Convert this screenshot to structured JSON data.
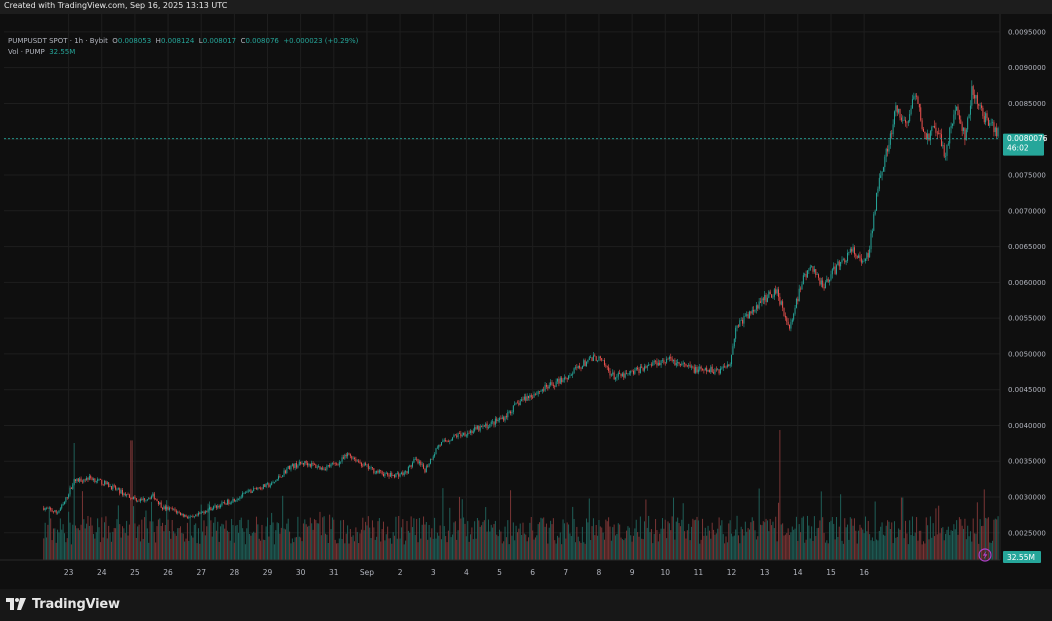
{
  "header": {
    "snapshot_label": "Created with TradingView.com, Sep 16, 2025 13:13 UTC"
  },
  "legend": {
    "symbol": "PUMPUSDT SPOT · 1h · Bybit",
    "open_label": "O",
    "open": "0.008053",
    "high_label": "H",
    "high": "0.008124",
    "low_label": "L",
    "low": "0.008017",
    "close_label": "C",
    "close": "0.008076",
    "change": "+0.000023 (+0.29%)",
    "volume_label": "Vol · PUMP",
    "volume": "32.55M"
  },
  "price_tag": {
    "price": "0.0080076",
    "countdown": "46:02"
  },
  "volume_tag": "32.55M",
  "branding": {
    "name": "TradingView"
  },
  "colors": {
    "up": "#26a69a",
    "down": "#ef5350",
    "up_volume": "#1f5f58",
    "down_volume": "#7a3535",
    "grid": "#1e1e1e",
    "background": "#0f0f0f"
  },
  "icons": {
    "alert": "lightning-icon"
  },
  "chart_data": {
    "type": "candlestick",
    "symbol": "PUMPUSDT",
    "interval": "1h",
    "exchange": "Bybit",
    "y_ticks": [
      "0.0025000",
      "0.0030000",
      "0.0035000",
      "0.0040000",
      "0.0045000",
      "0.0050000",
      "0.0055000",
      "0.0060000",
      "0.0065000",
      "0.0070000",
      "0.0075000",
      "0.0080000",
      "0.0085000",
      "0.0090000",
      "0.0095000"
    ],
    "ylim": [
      0.00212,
      0.00975
    ],
    "x_labels": [
      "23",
      "24",
      "25",
      "26",
      "27",
      "28",
      "29",
      "30",
      "31",
      "Sep",
      "2",
      "3",
      "4",
      "5",
      "6",
      "7",
      "8",
      "9",
      "10",
      "11",
      "12",
      "13",
      "14",
      "15",
      "16"
    ],
    "x_range_days": [
      -0.9,
      24.6
    ],
    "last_price": 0.0080076,
    "price_path": [
      [
        -0.9,
        0.00285
      ],
      [
        -0.5,
        0.00278
      ],
      [
        -0.3,
        0.0029
      ],
      [
        0.0,
        0.00322
      ],
      [
        0.5,
        0.00327
      ],
      [
        1.0,
        0.00318
      ],
      [
        1.5,
        0.00305
      ],
      [
        2.0,
        0.00295
      ],
      [
        2.4,
        0.00302
      ],
      [
        2.7,
        0.00285
      ],
      [
        3.0,
        0.00282
      ],
      [
        3.3,
        0.00275
      ],
      [
        3.6,
        0.0027
      ],
      [
        4.0,
        0.00282
      ],
      [
        4.5,
        0.0029
      ],
      [
        5.0,
        0.003
      ],
      [
        5.5,
        0.00312
      ],
      [
        6.0,
        0.00318
      ],
      [
        6.5,
        0.00342
      ],
      [
        7.0,
        0.00348
      ],
      [
        7.5,
        0.0034
      ],
      [
        8.0,
        0.00348
      ],
      [
        8.3,
        0.0036
      ],
      [
        8.7,
        0.00346
      ],
      [
        9.0,
        0.00338
      ],
      [
        9.5,
        0.0033
      ],
      [
        10.0,
        0.00333
      ],
      [
        10.3,
        0.00352
      ],
      [
        10.6,
        0.00338
      ],
      [
        11.0,
        0.00372
      ],
      [
        11.5,
        0.00385
      ],
      [
        12.0,
        0.00392
      ],
      [
        12.5,
        0.004
      ],
      [
        13.0,
        0.00412
      ],
      [
        13.5,
        0.00435
      ],
      [
        14.0,
        0.00447
      ],
      [
        14.5,
        0.00458
      ],
      [
        15.0,
        0.00472
      ],
      [
        15.5,
        0.0049
      ],
      [
        15.8,
        0.00495
      ],
      [
        16.0,
        0.00485
      ],
      [
        16.3,
        0.00468
      ],
      [
        16.7,
        0.0047
      ],
      [
        17.0,
        0.00477
      ],
      [
        17.5,
        0.00488
      ],
      [
        18.0,
        0.00492
      ],
      [
        18.3,
        0.00485
      ],
      [
        18.6,
        0.0048
      ],
      [
        19.0,
        0.00476
      ],
      [
        19.5,
        0.00478
      ],
      [
        19.8,
        0.00488
      ],
      [
        20.0,
        0.0054
      ],
      [
        20.5,
        0.0056
      ],
      [
        20.8,
        0.00575
      ],
      [
        21.2,
        0.0059
      ],
      [
        21.6,
        0.00535
      ],
      [
        22.0,
        0.00605
      ],
      [
        22.3,
        0.0062
      ],
      [
        22.6,
        0.00595
      ],
      [
        23.0,
        0.0062
      ],
      [
        23.5,
        0.00645
      ],
      [
        23.8,
        0.00625
      ],
      [
        24.0,
        0.0064
      ],
      [
        24.3,
        0.0075
      ],
      [
        24.6,
        0.0079
      ],
      [
        24.8,
        0.0084
      ],
      [
        25.1,
        0.0082
      ],
      [
        25.4,
        0.0086
      ],
      [
        25.7,
        0.008
      ],
      [
        26.0,
        0.00815
      ],
      [
        26.3,
        0.0078
      ],
      [
        26.6,
        0.00845
      ],
      [
        26.9,
        0.008
      ],
      [
        27.1,
        0.00865
      ],
      [
        27.4,
        0.0084
      ],
      [
        27.6,
        0.0082
      ],
      [
        27.9,
        0.00808
      ]
    ],
    "volume_spikes": [
      [
        0.0,
        0.9
      ],
      [
        1.75,
        0.92
      ],
      [
        4.1,
        0.45
      ],
      [
        20.7,
        0.55
      ],
      [
        21.3,
        1.0
      ],
      [
        24.2,
        0.45
      ],
      [
        25.0,
        0.48
      ]
    ]
  }
}
